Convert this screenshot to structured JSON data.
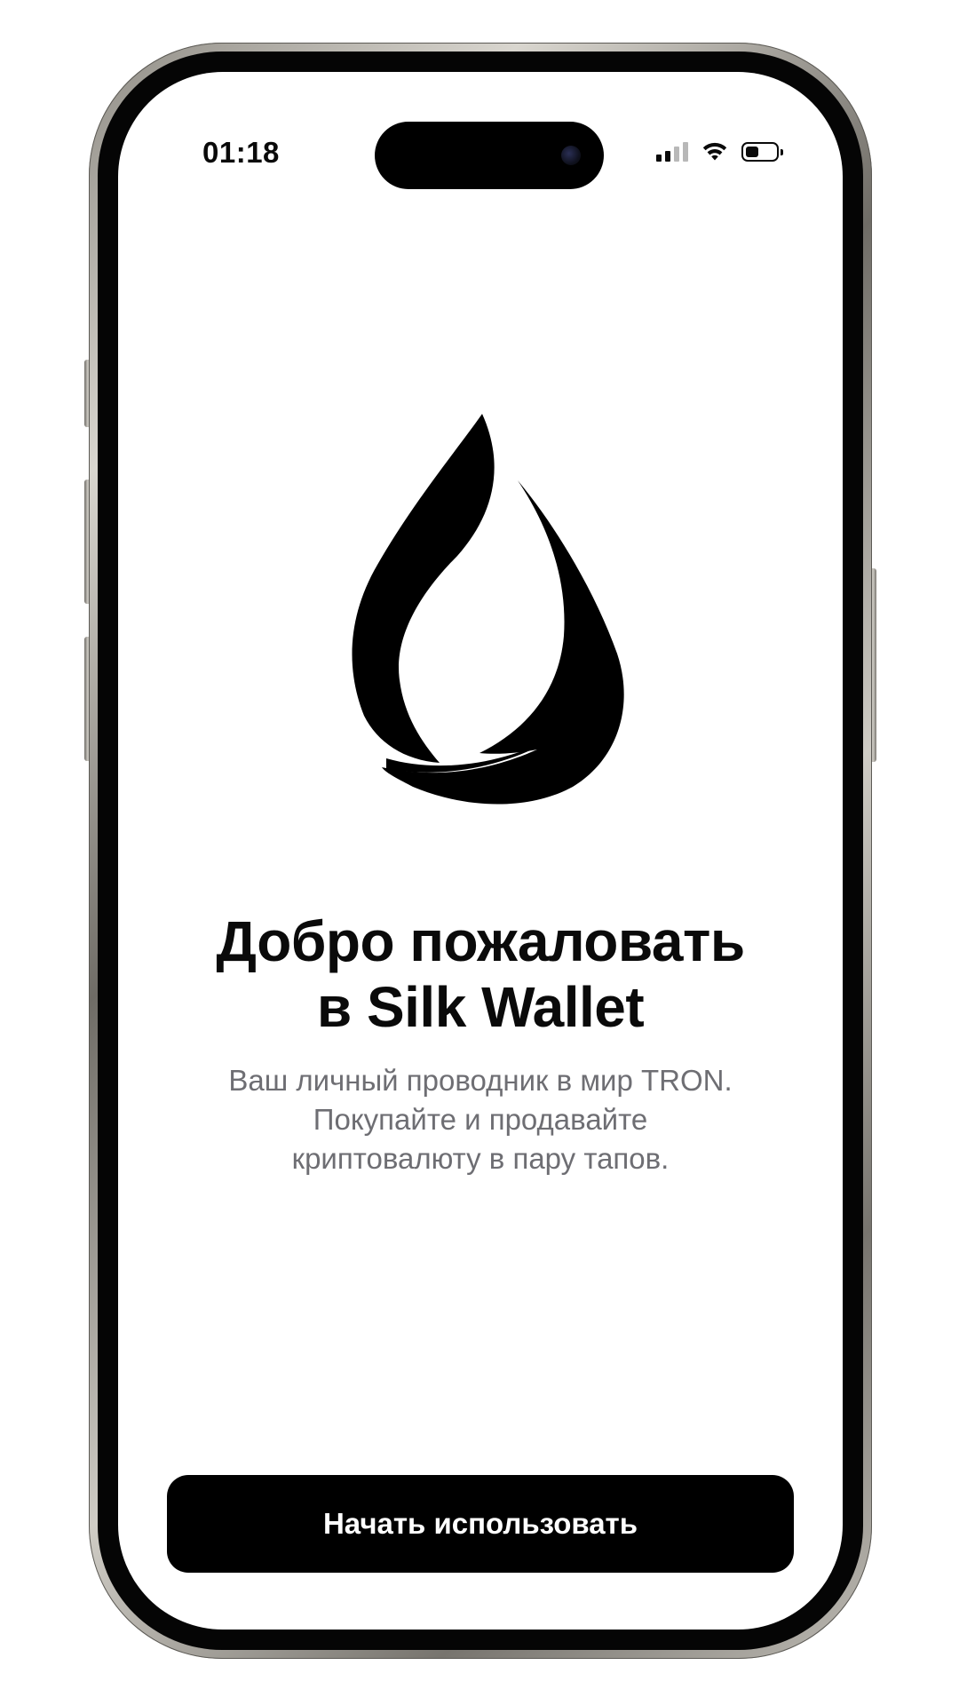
{
  "status_bar": {
    "time": "01:18",
    "signal_icon": "cellular-signal-icon",
    "signal_bars_active": 2,
    "signal_bars_total": 4,
    "wifi_icon": "wifi-icon",
    "battery_icon": "battery-icon",
    "battery_level": 0.45
  },
  "logo": {
    "icon": "silk-drop-logo-icon",
    "color": "#000000"
  },
  "welcome": {
    "title_line1": "Добро пожаловать",
    "title_line2": "в Silk Wallet",
    "subtitle_line1": "Ваш личный проводник в мир TRON.",
    "subtitle_line2": "Покупайте и продавайте",
    "subtitle_line3": "криптовалюту в пару тапов."
  },
  "cta": {
    "start_label": "Начать использовать",
    "background": "#000000",
    "text_color": "#ffffff"
  },
  "colors": {
    "title": "#0a0a0a",
    "subtitle": "#6e6e73",
    "screen_background": "#ffffff"
  }
}
